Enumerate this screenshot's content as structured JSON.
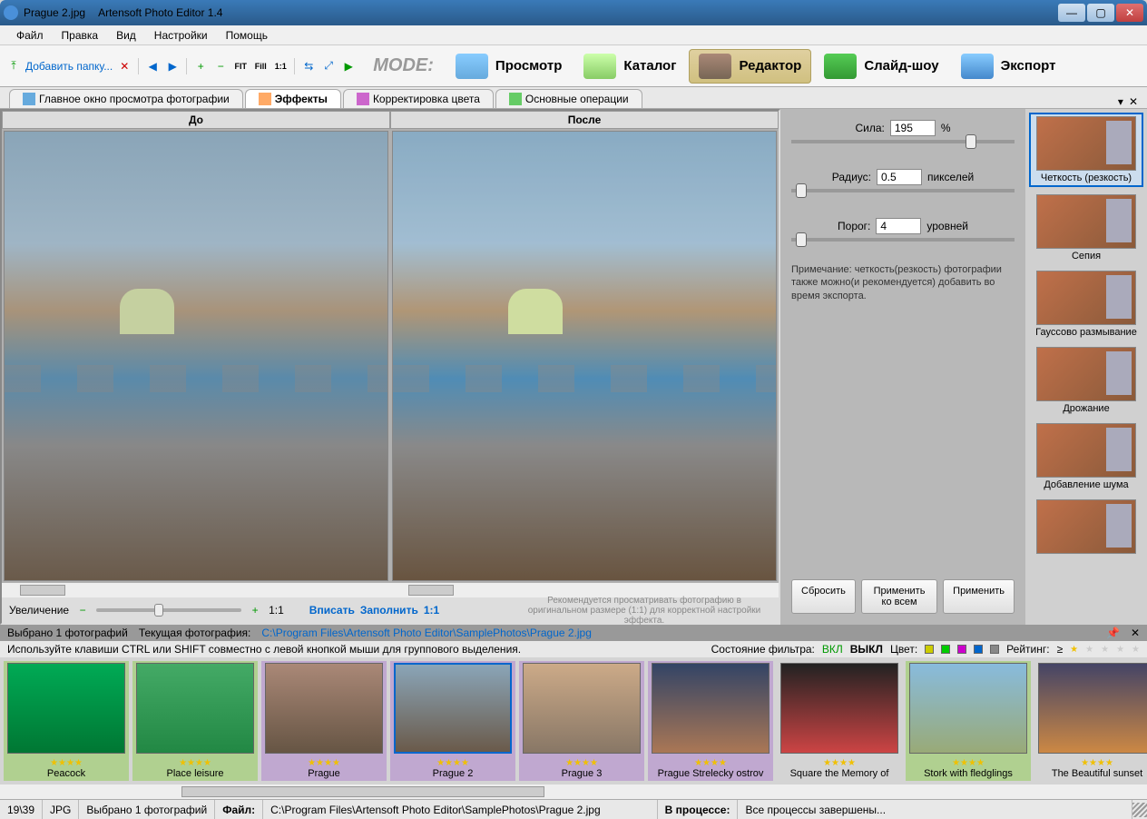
{
  "titlebar": {
    "file": "Prague 2.jpg",
    "app": "Artensoft Photo Editor 1.4"
  },
  "menu": {
    "file": "Файл",
    "edit": "Правка",
    "view": "Вид",
    "settings": "Настройки",
    "help": "Помощь"
  },
  "toolbar": {
    "add_folder": "Добавить папку...",
    "fit": "FIT",
    "fill": "Fill",
    "oneone": "1:1"
  },
  "modes": {
    "label": "MODE:",
    "view": "Просмотр",
    "catalog": "Каталог",
    "editor": "Редактор",
    "slideshow": "Слайд-шоу",
    "export": "Экспорт"
  },
  "subtabs": {
    "main_preview": "Главное окно просмотра фотографии",
    "effects": "Эффекты",
    "color_correction": "Корректировка цвета",
    "basic_ops": "Основные операции"
  },
  "preview": {
    "before": "До",
    "after": "После"
  },
  "zoom": {
    "label": "Увеличение",
    "oneone": "1:1",
    "fit": "Вписать",
    "fill": "Заполнить",
    "oneone2": "1:1",
    "hint": "Рекомендуется просматривать фотографию в оригинальном размере (1:1) для корректной настройки эффекта."
  },
  "params": {
    "strength_label": "Сила:",
    "strength_value": "195",
    "strength_unit": "%",
    "radius_label": "Радиус:",
    "radius_value": "0.5",
    "radius_unit": "пикселей",
    "threshold_label": "Порог:",
    "threshold_value": "4",
    "threshold_unit": "уровней",
    "note": "Примечание: четкость(резкость) фотографии также можно(и рекомендуется) добавить во время экспорта.",
    "reset": "Сбросить",
    "apply_all": "Применить ко всем",
    "apply": "Применить"
  },
  "effects": [
    "Четкость (резкость)",
    "Сепия",
    "Гауссово размывание",
    "Дрожание",
    "Добавление шума"
  ],
  "filmstrip_header": {
    "selected": "Выбрано 1  фотографий",
    "current_label": "Текущая фотография:",
    "path": "C:\\Program Files\\Artensoft Photo Editor\\SamplePhotos\\Prague 2.jpg"
  },
  "filmstrip_controls": {
    "hint": "Используйте клавиши CTRL или SHIFT совместно с левой кнопкой мыши для группового выделения.",
    "filter_state": "Состояние фильтра:",
    "on": "ВКЛ",
    "off": "ВЫКЛ",
    "color": "Цвет:",
    "rating": "Рейтинг:",
    "gte": "≥"
  },
  "thumbs": [
    {
      "label": "Peacock",
      "bg": "green",
      "img": "linear-gradient(#0a5, #073)"
    },
    {
      "label": "Place leisure",
      "bg": "green",
      "img": "linear-gradient(#4a6, #284)"
    },
    {
      "label": "Prague",
      "bg": "violet",
      "img": "linear-gradient(#a87, #654)"
    },
    {
      "label": "Prague 2",
      "bg": "violet",
      "img": "linear-gradient(#8aa5b8, #6a5a4a)",
      "selected": true
    },
    {
      "label": "Prague 3",
      "bg": "violet",
      "img": "linear-gradient(#ca8, #876)"
    },
    {
      "label": "Prague Strelecky ostrov",
      "bg": "violet",
      "img": "linear-gradient(#346, #a75)"
    },
    {
      "label": "Square the Memory of",
      "bg": "",
      "img": "linear-gradient(#222, #c44)"
    },
    {
      "label": "Stork with fledglings",
      "bg": "green",
      "img": "linear-gradient(#8bd, #9a7)"
    },
    {
      "label": "The Beautiful sunset",
      "bg": "",
      "img": "linear-gradient(#446, #c84)"
    }
  ],
  "status": {
    "count": "19\\39",
    "format": "JPG",
    "selected": "Выбрано 1 фотографий",
    "file_label": "Файл:",
    "file_path": "C:\\Program Files\\Artensoft Photo Editor\\SamplePhotos\\Prague 2.jpg",
    "process_label": "В процессе:",
    "process_text": "Все процессы завершены..."
  }
}
